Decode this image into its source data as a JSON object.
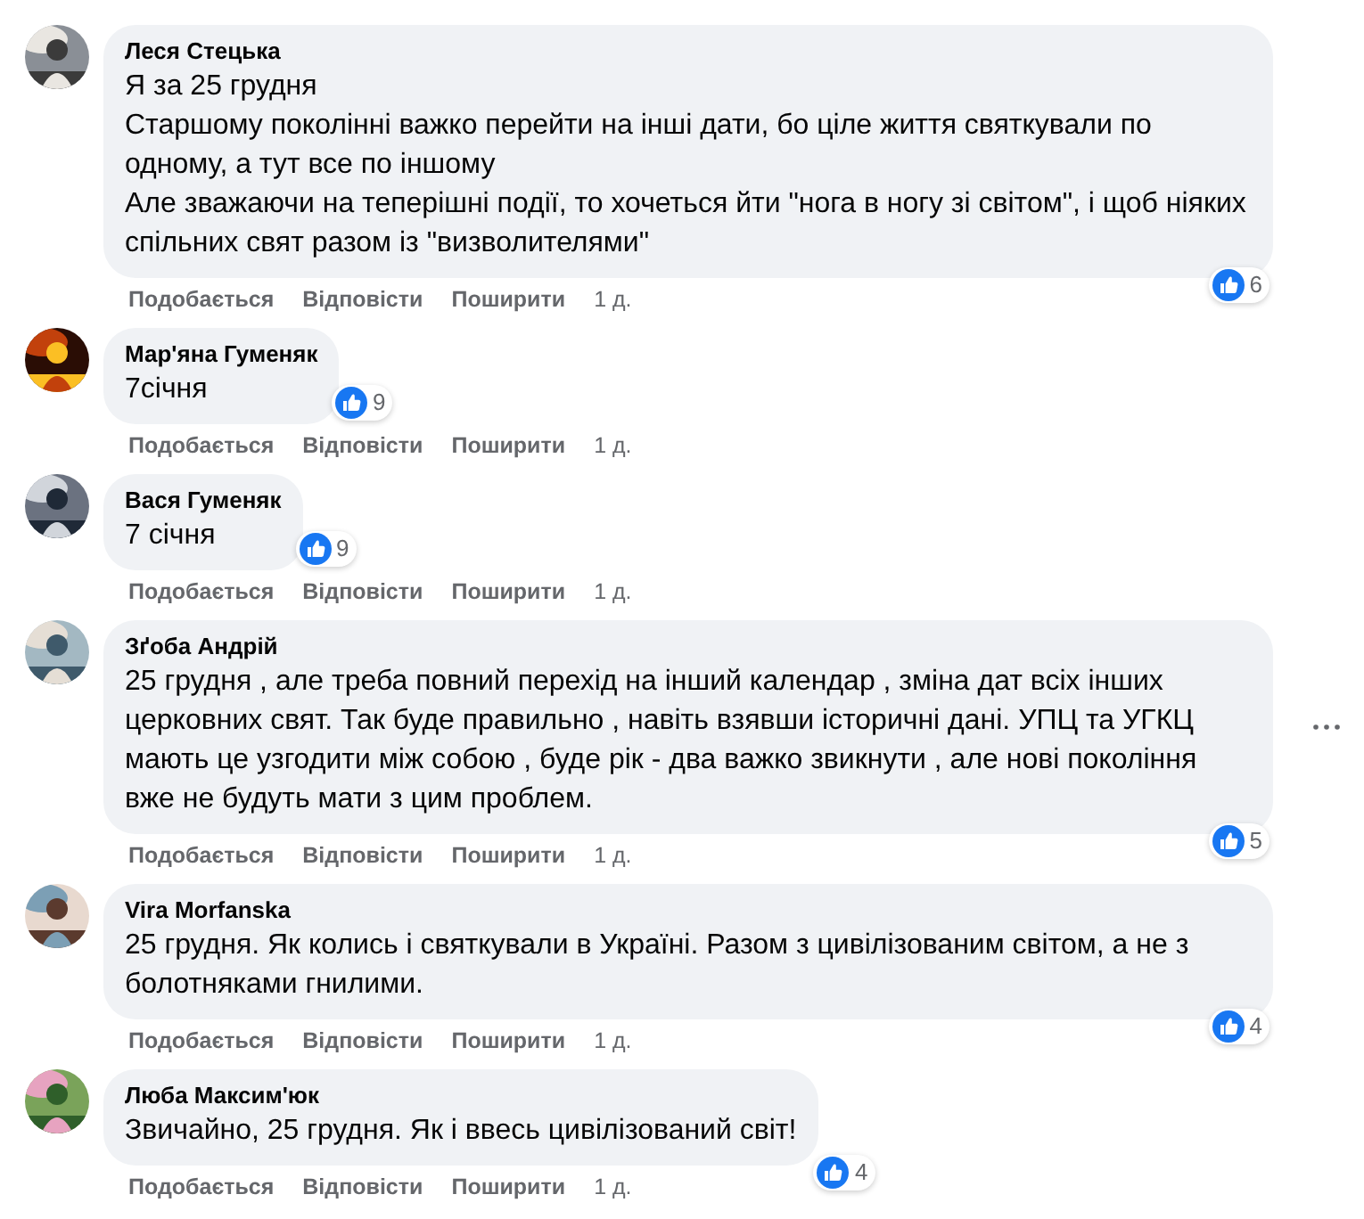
{
  "comments": [
    {
      "author": "Леся Стецька",
      "paragraphs": [
        "Я за 25 грудня",
        "Старшому поколінні важко перейти на інші дати, бо ціле життя святкували по одному, а тут все по іншому",
        "Але зважаючи на теперішні події, то хочеться йти \"нога в ногу зі світом\", і щоб ніяких спільних свят разом із \"визволителями\""
      ],
      "kind": "long",
      "reactions": "6",
      "menu_shown": false,
      "actions": [
        "Подобається",
        "Відповісти",
        "Поширити"
      ],
      "time": "1 д."
    },
    {
      "author": "Мар'яна Гуменяк",
      "paragraphs": [
        "7січня"
      ],
      "kind": "short",
      "reactions": "9",
      "menu_shown": false,
      "actions": [
        "Подобається",
        "Відповісти",
        "Поширити"
      ],
      "time": "1 д."
    },
    {
      "author": "Вася Гуменяк",
      "paragraphs": [
        "7 січня"
      ],
      "kind": "short",
      "reactions": "9",
      "menu_shown": false,
      "actions": [
        "Подобається",
        "Відповісти",
        "Поширити"
      ],
      "time": "1 д."
    },
    {
      "author": "Зґоба Андрій",
      "paragraphs": [
        "25 грудня , але треба повний перехід на інший календар , зміна дат всіх інших церковних свят. Так буде правильно , навіть взявши історичні дані. УПЦ та УГКЦ мають це узгодити між собою , буде рік - два важко звикнути , але нові покоління вже не будуть мати з цим проблем."
      ],
      "kind": "long",
      "reactions": "5",
      "menu_shown": true,
      "actions": [
        "Подобається",
        "Відповісти",
        "Поширити"
      ],
      "time": "1 д."
    },
    {
      "author": "Vira Morfanska",
      "paragraphs": [
        "25 грудня. Як колись і святкували в Україні. Разом з цивілізованим світом, а не з болотняками гнилими."
      ],
      "kind": "long",
      "reactions": "4",
      "menu_shown": false,
      "actions": [
        "Подобається",
        "Відповісти",
        "Поширити"
      ],
      "time": "1 д."
    },
    {
      "author": "Люба Максим'юк",
      "paragraphs": [
        "Звичайно, 25 грудня. Як і ввесь цивілізований світ!"
      ],
      "kind": "short-below",
      "reactions": "4",
      "menu_shown": false,
      "actions": [
        "Подобається",
        "Відповісти",
        "Поширити"
      ],
      "time": "1 д."
    }
  ]
}
